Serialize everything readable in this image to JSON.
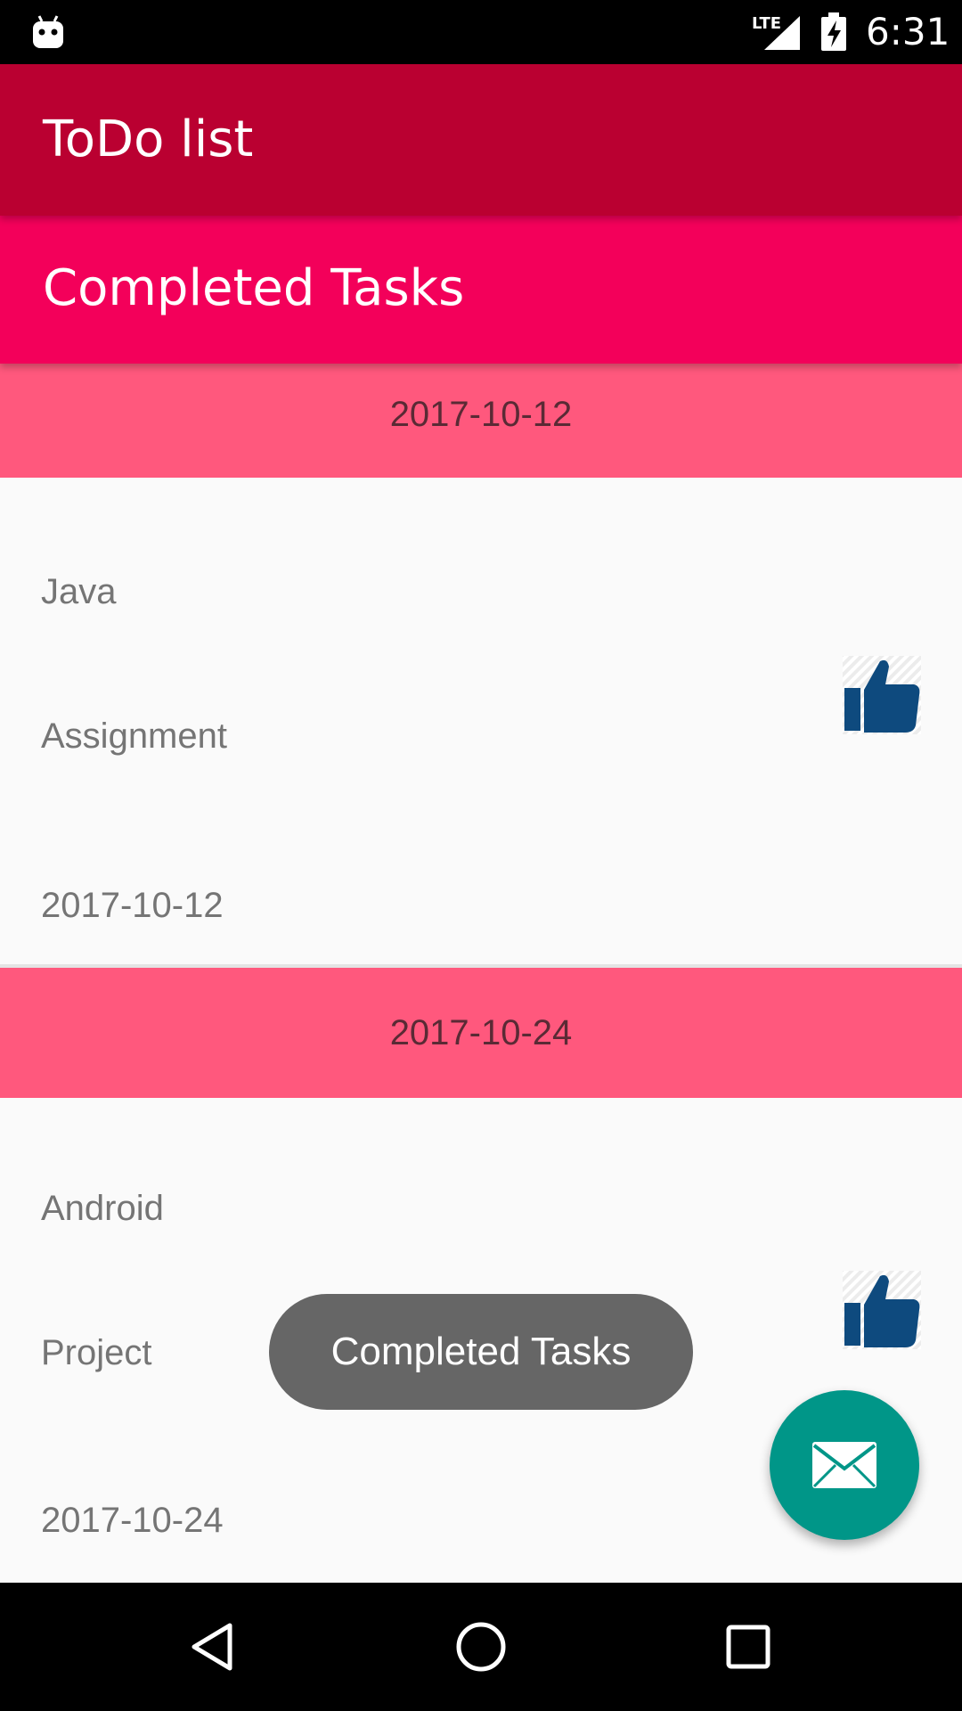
{
  "status_bar": {
    "time": "6:31",
    "network_label": "LTE",
    "icons": [
      "android-debug-icon",
      "lte-signal-icon",
      "battery-charging-icon"
    ]
  },
  "app_bar": {
    "title": "ToDo list"
  },
  "sub_header": {
    "title": "Completed Tasks"
  },
  "tasks": [
    {
      "date_header": "2017-10-12",
      "name": "Java",
      "category": "Assignment",
      "date": "2017-10-12",
      "status_icon": "thumbs-up-icon"
    },
    {
      "date_header": "2017-10-24",
      "name": "Android",
      "category": "Project",
      "date": "2017-10-24",
      "status_icon": "thumbs-up-icon"
    }
  ],
  "toast": {
    "message": "Completed Tasks"
  },
  "fab": {
    "icon": "mail-icon"
  },
  "nav_bar": {
    "buttons": [
      "back-icon",
      "home-icon",
      "recents-icon"
    ]
  },
  "colors": {
    "app_bar": "#ba0031",
    "sub_header": "#f3005a",
    "date_banner": "#ff587d",
    "fab": "#009688",
    "thumb": "#0e4a7e",
    "toast": "#666666"
  }
}
